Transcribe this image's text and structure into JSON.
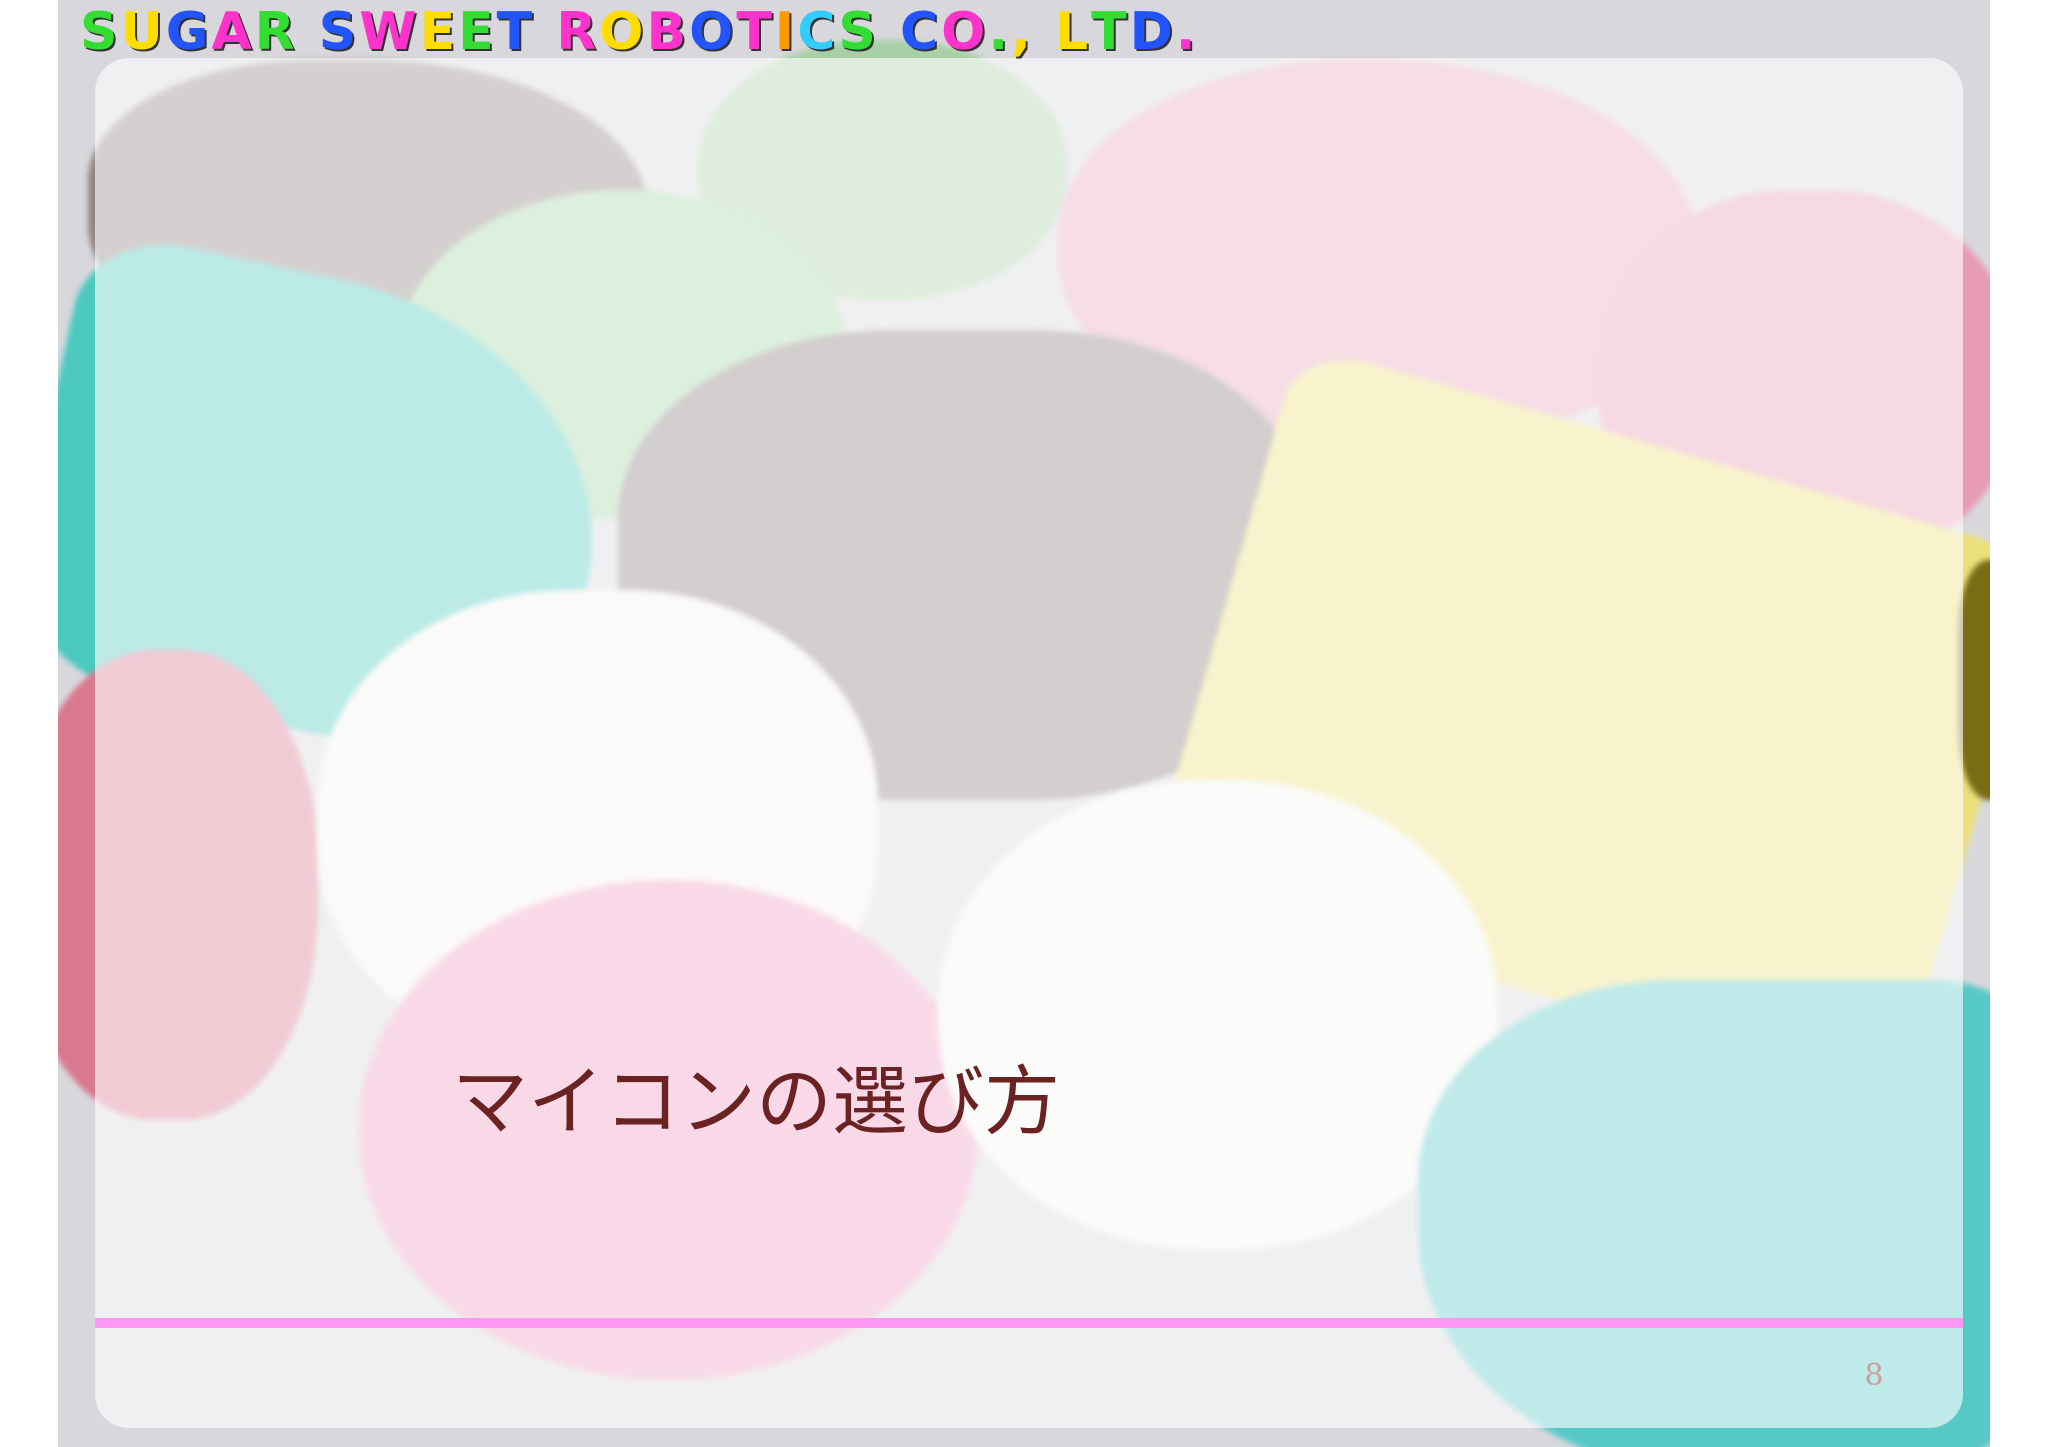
{
  "header": {
    "company_letters": [
      {
        "ch": "S",
        "color": "#33dd33"
      },
      {
        "ch": "U",
        "color": "#ffdd00"
      },
      {
        "ch": "G",
        "color": "#2255ff"
      },
      {
        "ch": "A",
        "color": "#ff33cc"
      },
      {
        "ch": "R",
        "color": "#33dd33"
      },
      {
        "ch": " ",
        "color": "#000000"
      },
      {
        "ch": "S",
        "color": "#2255ff"
      },
      {
        "ch": "W",
        "color": "#ff33cc"
      },
      {
        "ch": "E",
        "color": "#ffdd00"
      },
      {
        "ch": "E",
        "color": "#33dd33"
      },
      {
        "ch": "T",
        "color": "#2255ff"
      },
      {
        "ch": " ",
        "color": "#000000"
      },
      {
        "ch": "R",
        "color": "#ff33cc"
      },
      {
        "ch": "O",
        "color": "#ffdd00"
      },
      {
        "ch": "B",
        "color": "#ff33cc"
      },
      {
        "ch": "O",
        "color": "#2255ff"
      },
      {
        "ch": "T",
        "color": "#ff33cc"
      },
      {
        "ch": "I",
        "color": "#ff9900"
      },
      {
        "ch": "C",
        "color": "#33ccff"
      },
      {
        "ch": "S",
        "color": "#33dd33"
      },
      {
        "ch": " ",
        "color": "#000000"
      },
      {
        "ch": "C",
        "color": "#2255ff"
      },
      {
        "ch": "O",
        "color": "#ff33cc"
      },
      {
        "ch": ".",
        "color": "#33dd33"
      },
      {
        "ch": ",",
        "color": "#ffdd00"
      },
      {
        "ch": " ",
        "color": "#000000"
      },
      {
        "ch": "L",
        "color": "#ffdd00"
      },
      {
        "ch": "T",
        "color": "#33dd33"
      },
      {
        "ch": "D",
        "color": "#2255ff"
      },
      {
        "ch": ".",
        "color": "#ff33cc"
      }
    ]
  },
  "slide": {
    "title": "マイコンの選び方",
    "page_number": "8"
  },
  "colors": {
    "title_text": "#6b2222",
    "divider": "#ff99f5",
    "page_number": "#c9a09c"
  }
}
